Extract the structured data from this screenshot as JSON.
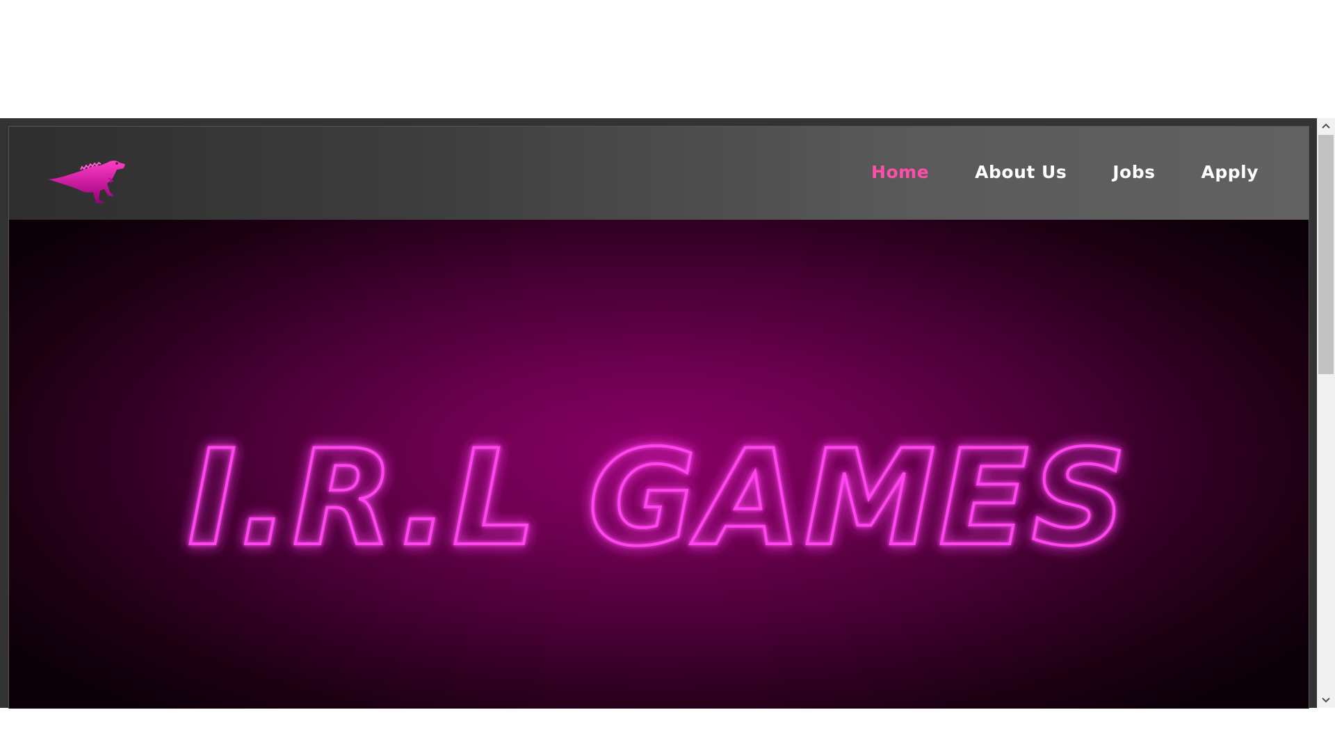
{
  "brand": {
    "logo_icon": "pink-dinosaur-icon",
    "accent_color": "#ff4fa8",
    "neon_color": "#ff33e0"
  },
  "nav": {
    "items": [
      {
        "label": "Home",
        "active": true
      },
      {
        "label": "About Us",
        "active": false
      },
      {
        "label": "Jobs",
        "active": false
      },
      {
        "label": "Apply",
        "active": false
      }
    ]
  },
  "hero": {
    "title": "I.R.L GAMES"
  },
  "scrollbar": {
    "up_icon": "chevron-up-icon",
    "down_icon": "chevron-down-icon"
  }
}
